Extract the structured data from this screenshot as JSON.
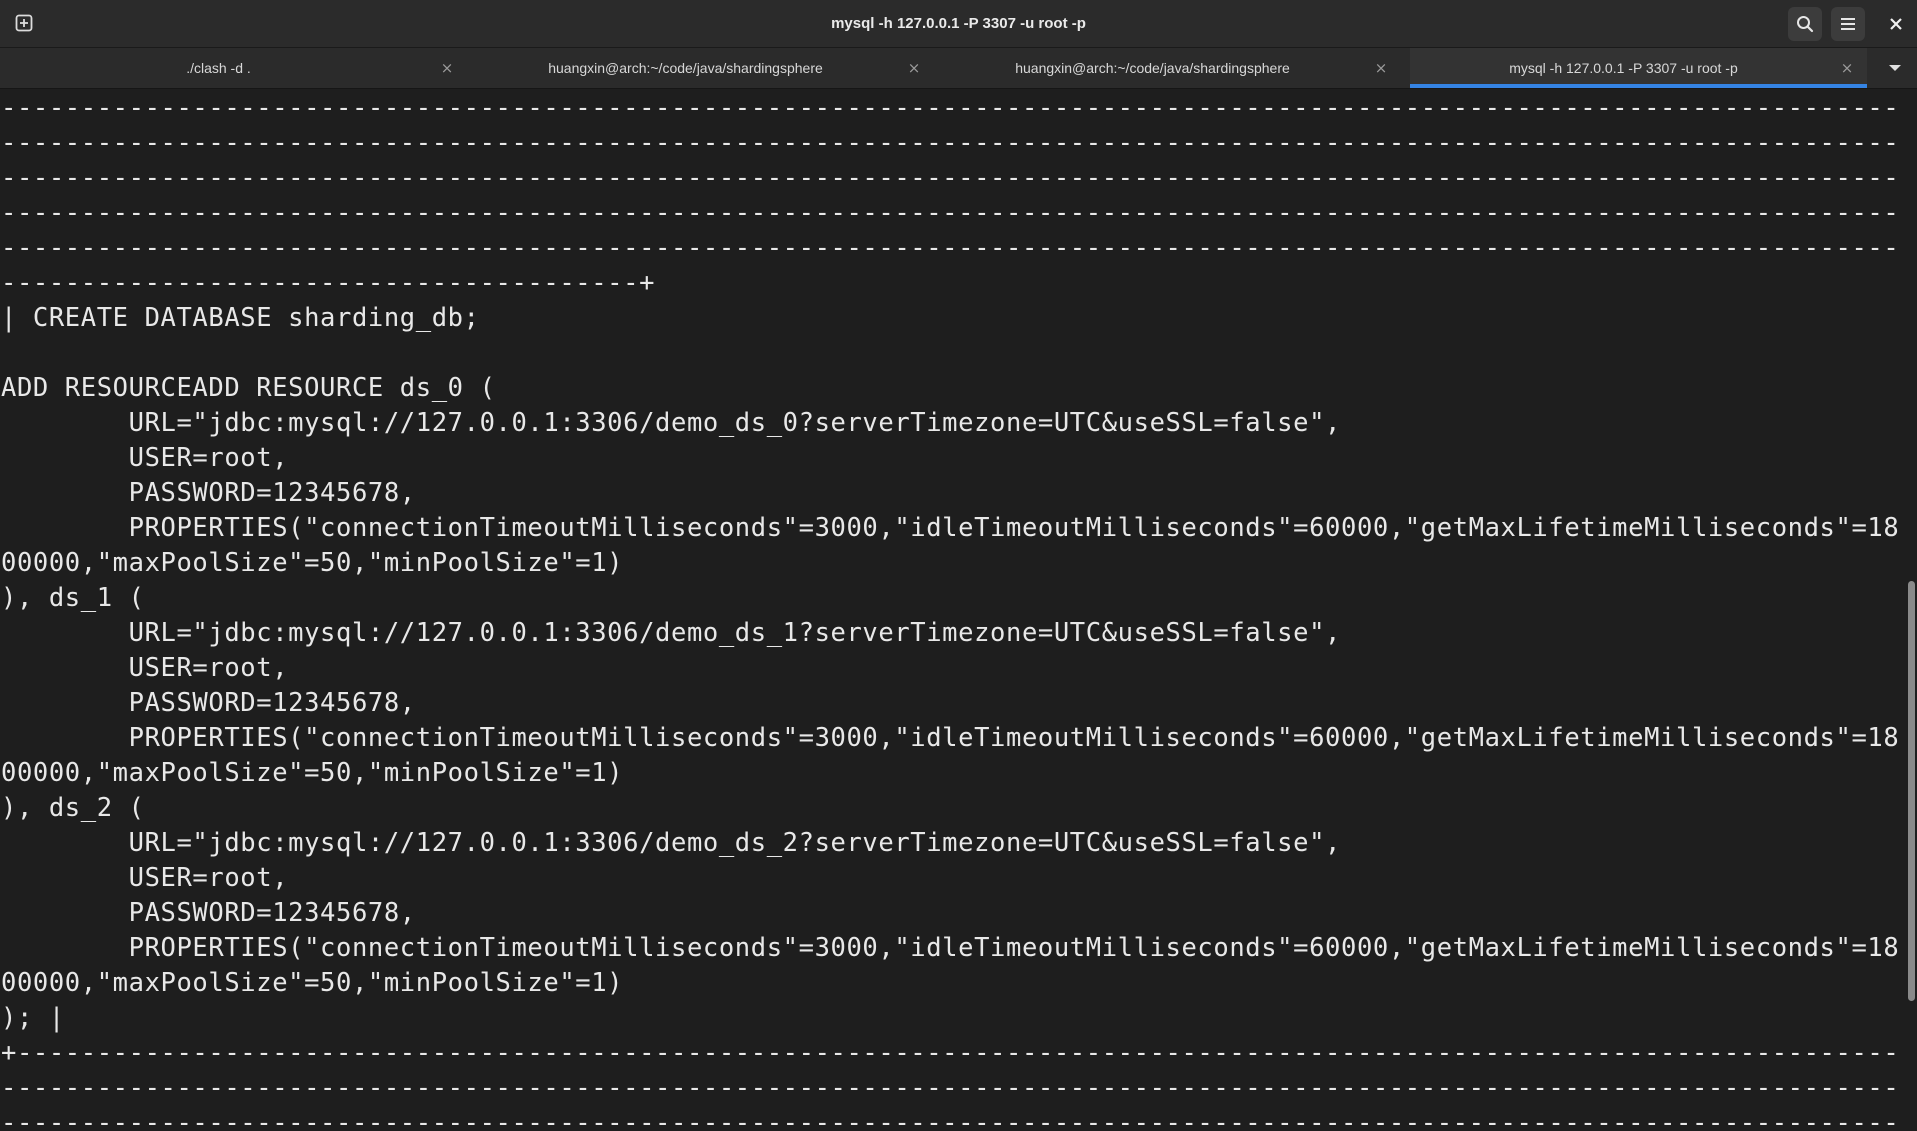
{
  "window": {
    "title": "mysql -h 127.0.0.1 -P 3307 -u root -p"
  },
  "tabs": [
    {
      "label": "./clash -d .",
      "active": false
    },
    {
      "label": "huangxin@arch:~/code/java/shardingsphere",
      "active": false
    },
    {
      "label": "huangxin@arch:~/code/java/shardingsphere",
      "active": false
    },
    {
      "label": "mysql -h 127.0.0.1 -P 3307 -u root -p",
      "active": true
    }
  ],
  "tab_close_glyph": "×",
  "icons": {
    "new_tab": "new-tab-icon",
    "search": "search-icon",
    "menu": "hamburger-menu-icon",
    "close": "close-icon",
    "tab_dropdown": "chevron-down-icon"
  },
  "colors": {
    "background": "#1e1e1e",
    "titlebar": "#2b2b2b",
    "accent": "#3584e4",
    "text": "#e8e8e8"
  },
  "terminal": {
    "lines": [
      "-----------------------------------------------------------------------------------------------------------------------",
      "-----------------------------------------------------------------------------------------------------------------------",
      "-----------------------------------------------------------------------------------------------------------------------",
      "-----------------------------------------------------------------------------------------------------------------------",
      "-----------------------------------------------------------------------------------------------------------------------",
      "----------------------------------------+",
      "| CREATE DATABASE sharding_db;",
      "",
      "ADD RESOURCEADD RESOURCE ds_0 (",
      "        URL=\"jdbc:mysql://127.0.0.1:3306/demo_ds_0?serverTimezone=UTC&useSSL=false\",",
      "        USER=root,",
      "        PASSWORD=12345678,",
      "        PROPERTIES(\"connectionTimeoutMilliseconds\"=3000,\"idleTimeoutMilliseconds\"=60000,\"getMaxLifetimeMilliseconds\"=18",
      "00000,\"maxPoolSize\"=50,\"minPoolSize\"=1)",
      "), ds_1 (",
      "        URL=\"jdbc:mysql://127.0.0.1:3306/demo_ds_1?serverTimezone=UTC&useSSL=false\",",
      "        USER=root,",
      "        PASSWORD=12345678,",
      "        PROPERTIES(\"connectionTimeoutMilliseconds\"=3000,\"idleTimeoutMilliseconds\"=60000,\"getMaxLifetimeMilliseconds\"=18",
      "00000,\"maxPoolSize\"=50,\"minPoolSize\"=1)",
      "), ds_2 (",
      "        URL=\"jdbc:mysql://127.0.0.1:3306/demo_ds_2?serverTimezone=UTC&useSSL=false\",",
      "        USER=root,",
      "        PASSWORD=12345678,",
      "        PROPERTIES(\"connectionTimeoutMilliseconds\"=3000,\"idleTimeoutMilliseconds\"=60000,\"getMaxLifetimeMilliseconds\"=18",
      "00000,\"maxPoolSize\"=50,\"minPoolSize\"=1)",
      "); |",
      "+----------------------------------------------------------------------------------------------------------------------",
      "-----------------------------------------------------------------------------------------------------------------------",
      "-----------------------------------------------------------------------------------------------------------------------"
    ]
  }
}
